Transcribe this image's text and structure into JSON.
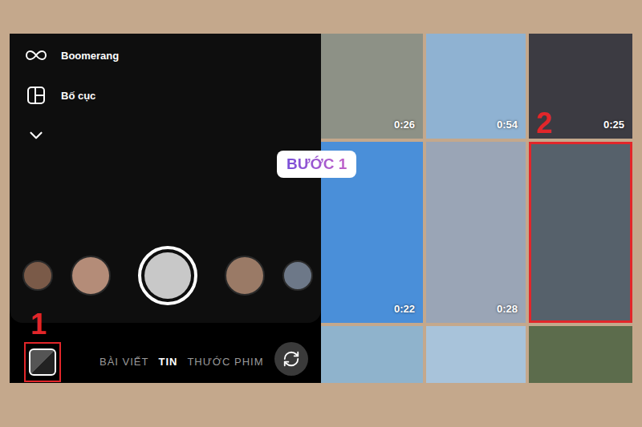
{
  "camera_menu": [
    {
      "label": "Boomerang",
      "icon": "infinity"
    },
    {
      "label": "Bố cục",
      "icon": "layout"
    }
  ],
  "mode_tabs": [
    {
      "label": "BÀI VIẾT",
      "selected": false
    },
    {
      "label": "TIN",
      "selected": true
    },
    {
      "label": "THƯỚC PHIM",
      "selected": false
    }
  ],
  "badge": "BƯỚC 1",
  "markers": [
    "1",
    "2"
  ],
  "gallery": [
    {
      "duration": "0:26",
      "selected": false,
      "color": "#8d9186"
    },
    {
      "duration": "0:54",
      "selected": false,
      "color": "#8fb2d2"
    },
    {
      "duration": "0:25",
      "selected": false,
      "color": "#3c3b42"
    },
    {
      "duration": "0:22",
      "selected": false,
      "color": "#4a8fd9"
    },
    {
      "duration": "0:28",
      "selected": false,
      "color": "#9aa5b6"
    },
    {
      "selected": true,
      "color": "#56616b"
    },
    {
      "selected": false,
      "color": "#8fb3cc"
    },
    {
      "selected": false,
      "color": "#a8c3da"
    },
    {
      "selected": false,
      "color": "#5c6c4c"
    }
  ]
}
